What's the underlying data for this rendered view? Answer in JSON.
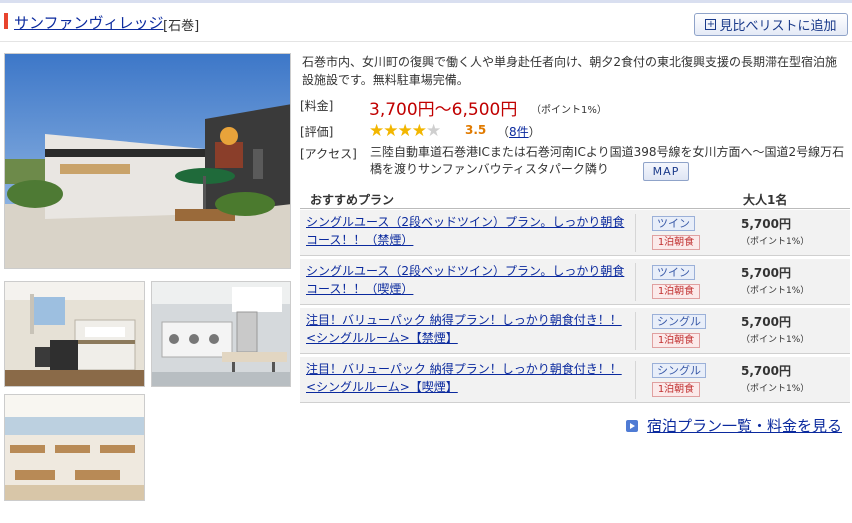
{
  "hotel": {
    "name": "サンファンヴィレッジ",
    "area": "[石巻]",
    "compare_button": "見比べリストに追加",
    "description": "石巻市内、女川町の復興で働く人や単身赴任者向け、朝夕2食付の東北復興支援の長期滞在型宿泊施設施設です。無料駐車場完備。"
  },
  "info": {
    "price_label": "[料金]",
    "price": "3,700円〜6,500円",
    "price_points": "（ポイント1%）",
    "rating_label": "[評価]",
    "rating_value": "3.5",
    "stars_filled": 4,
    "stars_total": 5,
    "reviews_open": "（",
    "reviews_count": "8件",
    "reviews_close": "）",
    "access_label": "[アクセス]",
    "access_text": "三陸自動車道石巻港ICまたは石巻河南ICより国道398号線を女川方面へ〜国道2号線万石橋を渡りサンファンバウティスタパーク隣り",
    "map_button": "MAP"
  },
  "plans_header": {
    "title": "おすすめプラン",
    "price_col": "大人1名"
  },
  "plans": [
    {
      "name": "シングルユース（2段ベッドツイン）プラン。しっかり朝食コース！！（禁煙）",
      "room": "ツイン",
      "meal": "1泊朝食",
      "price": "5,700円",
      "points": "（ポイント1%）"
    },
    {
      "name": "シングルユース（2段ベッドツイン）プラン。しっかり朝食コース！！（喫煙）",
      "room": "ツイン",
      "meal": "1泊朝食",
      "price": "5,700円",
      "points": "（ポイント1%）"
    },
    {
      "name": "注目！バリューパック 納得プラン！しっかり朝食付き！！ <シングルルーム>【禁煙】",
      "room": "シングル",
      "meal": "1泊朝食",
      "price": "5,700円",
      "points": "（ポイント1%）"
    },
    {
      "name": "注目！バリューパック 納得プラン！しっかり朝食付き！！<シングルルーム>【喫煙】",
      "room": "シングル",
      "meal": "1泊朝食",
      "price": "5,700円",
      "points": "（ポイント1%）"
    }
  ],
  "all_plans_link": "宿泊プラン一覧・料金を見る",
  "icons": {
    "compare": "plus-box-icon",
    "star": "star-icon",
    "link_arrow": "arrow-right-icon"
  },
  "colors": {
    "link": "#0b2a9e",
    "price": "#c00000",
    "accent_bar": "#e8442e",
    "star": "#f2b600"
  }
}
